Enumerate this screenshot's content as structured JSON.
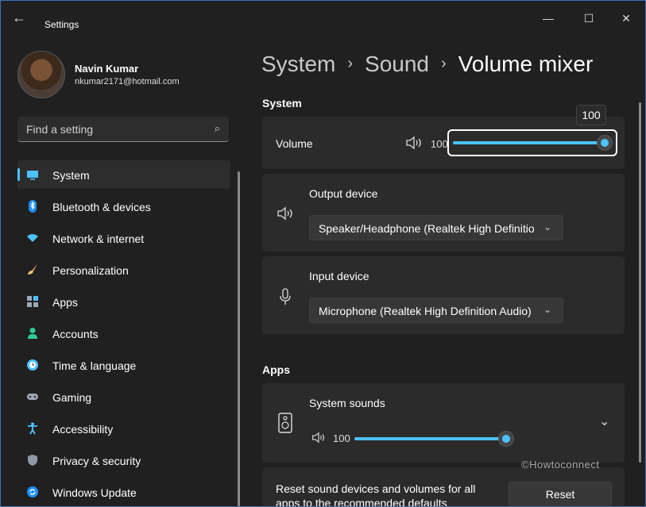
{
  "window": {
    "title": "Settings",
    "controls": {
      "minimize": "—",
      "maximize": "☐",
      "close": "✕"
    }
  },
  "user": {
    "name": "Navin Kumar",
    "email": "nkumar2171@hotmail.com"
  },
  "search": {
    "placeholder": "Find a setting"
  },
  "sidebar": {
    "items": [
      {
        "label": "System",
        "active": true
      },
      {
        "label": "Bluetooth & devices"
      },
      {
        "label": "Network & internet"
      },
      {
        "label": "Personalization"
      },
      {
        "label": "Apps"
      },
      {
        "label": "Accounts"
      },
      {
        "label": "Time & language"
      },
      {
        "label": "Gaming"
      },
      {
        "label": "Accessibility"
      },
      {
        "label": "Privacy & security"
      },
      {
        "label": "Windows Update"
      }
    ]
  },
  "breadcrumb": {
    "items": [
      "System",
      "Sound"
    ],
    "current": "Volume mixer"
  },
  "system_section": {
    "title": "System",
    "volume": {
      "label": "Volume",
      "value": "100",
      "tooltip": "100",
      "level_percent": 100
    },
    "output": {
      "label": "Output device",
      "selected": "Speaker/Headphone (Realtek High Definitio"
    },
    "input": {
      "label": "Input device",
      "selected": "Microphone (Realtek High Definition Audio)"
    }
  },
  "apps_section": {
    "title": "Apps",
    "system_sounds": {
      "label": "System sounds",
      "value": "100",
      "level_percent": 100
    },
    "reset": {
      "text_line1": "Reset sound devices and volumes for all",
      "text_line2": "apps to the recommended defaults",
      "button": "Reset"
    }
  },
  "watermark": "©Howtoconnect",
  "colors": {
    "accent": "#4cc2ff",
    "background": "#202020",
    "card": "#2b2b2b"
  }
}
